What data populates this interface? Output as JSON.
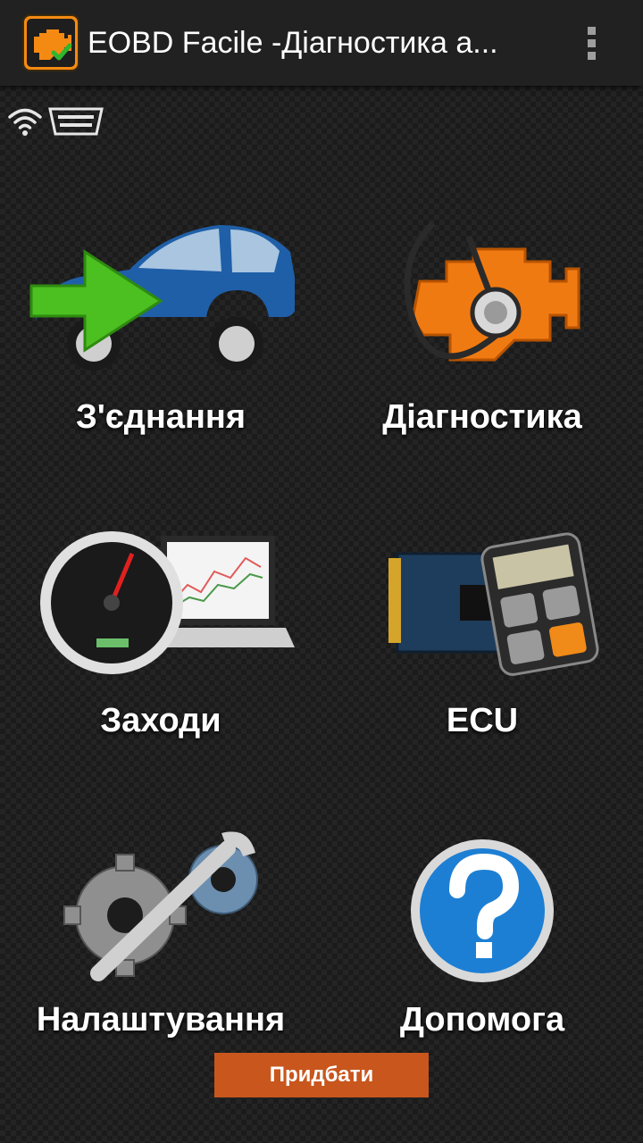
{
  "appbar": {
    "title": "EOBD Facile -Діагностика а...",
    "app_icon": "engine-check-icon",
    "menu_icon": "overflow-menu-icon"
  },
  "status": {
    "icons": [
      "wifi-icon",
      "obd-connector-icon"
    ]
  },
  "menu": {
    "items": [
      {
        "label": "З'єднання",
        "icon": "car-connect-icon"
      },
      {
        "label": "Діагностика",
        "icon": "engine-stethoscope-icon"
      },
      {
        "label": "Заходи",
        "icon": "speedometer-laptop-icon"
      },
      {
        "label": "ECU",
        "icon": "ecu-calculator-icon"
      },
      {
        "label": "Налаштування",
        "icon": "gears-wrench-icon"
      },
      {
        "label": "Допомога",
        "icon": "help-icon"
      }
    ]
  },
  "buy_button": {
    "label": "Придбати"
  },
  "colors": {
    "appbar": "#212121",
    "accent": "#c8561d",
    "engine_orange": "#f07a12",
    "help_blue": "#1d7fd4"
  }
}
